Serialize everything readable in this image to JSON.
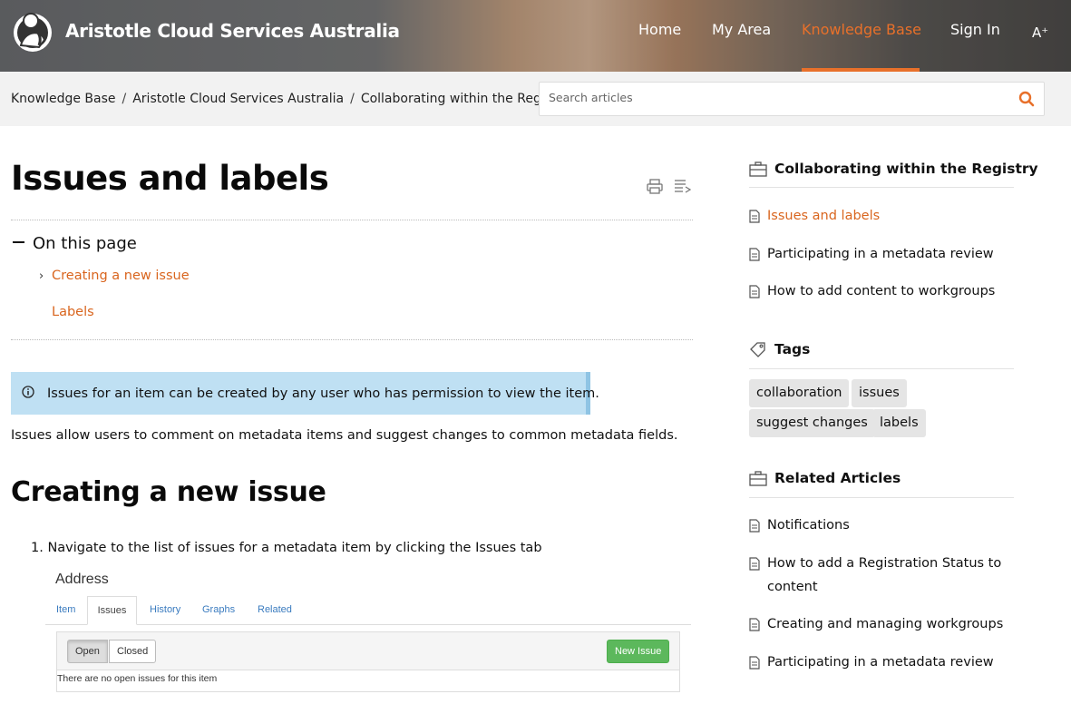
{
  "header": {
    "brand": "Aristotle Cloud Services Australia",
    "nav": [
      {
        "label": "Home"
      },
      {
        "label": "My Area"
      },
      {
        "label": "Knowledge Base"
      },
      {
        "label": "Sign In"
      }
    ],
    "a11y_label": "A⁺",
    "accent_color": "#e8702a"
  },
  "breadcrumb": {
    "items": [
      "Knowledge Base",
      "Aristotle Cloud Services Australia",
      "Collaborating within the Registry"
    ],
    "separator": "/"
  },
  "search": {
    "placeholder": "Search articles",
    "value": ""
  },
  "article": {
    "title": "Issues and labels",
    "toc_heading": "On this page",
    "toc": [
      "Creating a new issue",
      "Labels"
    ],
    "notice": "Issues for an item can be created by any user who has permission to view the item.",
    "intro": "Issues allow users to comment on metadata items and suggest changes to common metadata fields.",
    "section_heading": "Creating a new issue",
    "step_1": "1. Navigate to the list of issues for a metadata item by clicking the Issues tab",
    "screenshot": {
      "title": "Address",
      "tabs": [
        "Item",
        "Issues",
        "History",
        "Graphs",
        "Related"
      ],
      "filter_buttons": [
        "Open",
        "Closed"
      ],
      "new_button": "New Issue",
      "empty_text": "There are no open issues for this item"
    }
  },
  "sidebar": {
    "collection": {
      "heading": "Collaborating within the Registry",
      "items": [
        "Issues and labels",
        "Participating in a metadata review",
        "How to add content to workgroups"
      ]
    },
    "tags": {
      "heading": "Tags",
      "items": [
        "collaboration",
        "issues",
        "suggest changes",
        "labels"
      ]
    },
    "related": {
      "heading": "Related Articles",
      "items": [
        "Notifications",
        "How to add a Registration Status to content",
        "Creating and managing workgroups",
        "Participating in a metadata review"
      ]
    }
  }
}
